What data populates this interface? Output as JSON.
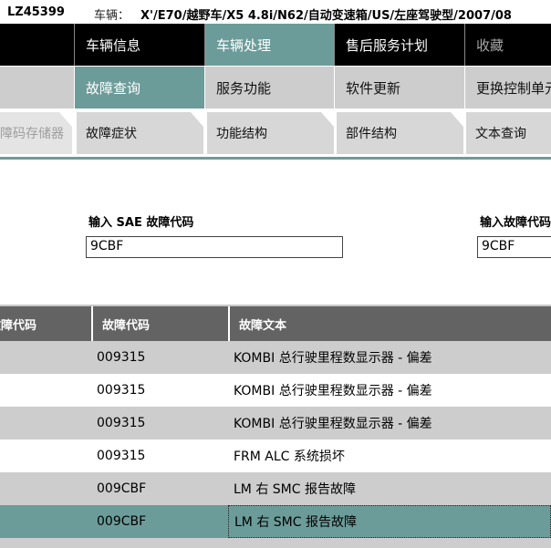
{
  "header": {
    "vehicle_id": "LZ45399",
    "vehicle_label": "车辆：",
    "vehicle_desc": "X'/E70/越野车/X5 4.8i/N62/自动变速箱/US/左座驾驶型/2007/08"
  },
  "nav_main": [
    "",
    "车辆信息",
    "车辆处理",
    "售后服务计划",
    "收藏"
  ],
  "nav_sub": [
    "",
    "故障查询",
    "服务功能",
    "软件更新",
    "更换控制单元"
  ],
  "nav_tabs": [
    "故障码存储器",
    "故障症状",
    "功能结构",
    "部件结构",
    "文本查询"
  ],
  "inputs": {
    "sae_label": "输入 SAE 故障代码",
    "sae_value": "9CBF",
    "code_label": "输入故障代码",
    "code_value": "9CBF"
  },
  "table": {
    "columns": [
      "故障代码",
      "故障代码",
      "故障文本"
    ],
    "rows": [
      {
        "code": "009315",
        "text": "KOMBI 总行驶里程数显示器 - 偏差"
      },
      {
        "code": "009315",
        "text": "KOMBI 总行驶里程数显示器 - 偏差"
      },
      {
        "code": "009315",
        "text": "KOMBI 总行驶里程数显示器 - 偏差"
      },
      {
        "code": "009315",
        "text": "FRM ALC 系统损坏"
      },
      {
        "code": "009CBF",
        "text": "LM 右 SMC 报告故障"
      },
      {
        "code": "009CBF",
        "text": "LM 右 SMC 报告故障"
      }
    ],
    "selected_row": 5
  },
  "colors": {
    "accent": "#6b9c9a",
    "header_bg": "#636363",
    "row_gray": "#cdcdcd"
  }
}
